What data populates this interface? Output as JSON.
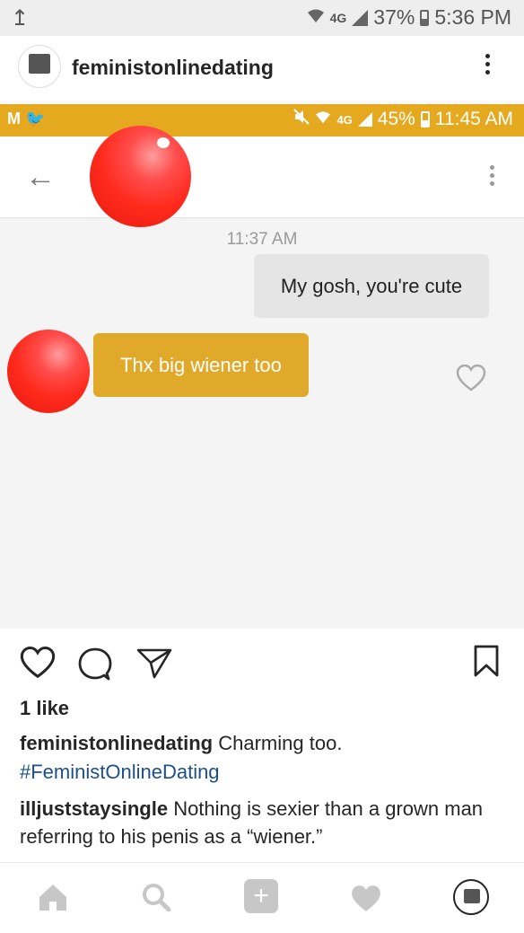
{
  "outer_status": {
    "upload_icon": "↥",
    "network": "4G",
    "battery": "37%",
    "time": "5:36 PM"
  },
  "header": {
    "username": "feministonlinedating"
  },
  "inner": {
    "status": {
      "left_icons": "M 🐦",
      "network": "4G",
      "battery": "45%",
      "time": "11:45 AM"
    },
    "back_icon": "←",
    "time_label": "11:37 AM",
    "outgoing_message": "My gosh, you're cute",
    "incoming_message": "Thx big wiener too"
  },
  "post": {
    "likes": "1 like",
    "caption_user": "feministonlinedating",
    "caption_text": "Charming too.",
    "hashtag": "#FeministOnlineDating",
    "comment_user": "illjuststaysingle",
    "comment_text": "Nothing is sexier than a grown man referring to his penis as a “wiener.”"
  },
  "colors": {
    "accent_yellow": "#e1a92a",
    "hashtag_blue": "#1d4f8c"
  },
  "icons": [
    "heart-icon",
    "comment-icon",
    "share-icon",
    "bookmark-icon",
    "home-icon",
    "search-icon",
    "add-icon",
    "activity-icon",
    "profile-icon"
  ]
}
